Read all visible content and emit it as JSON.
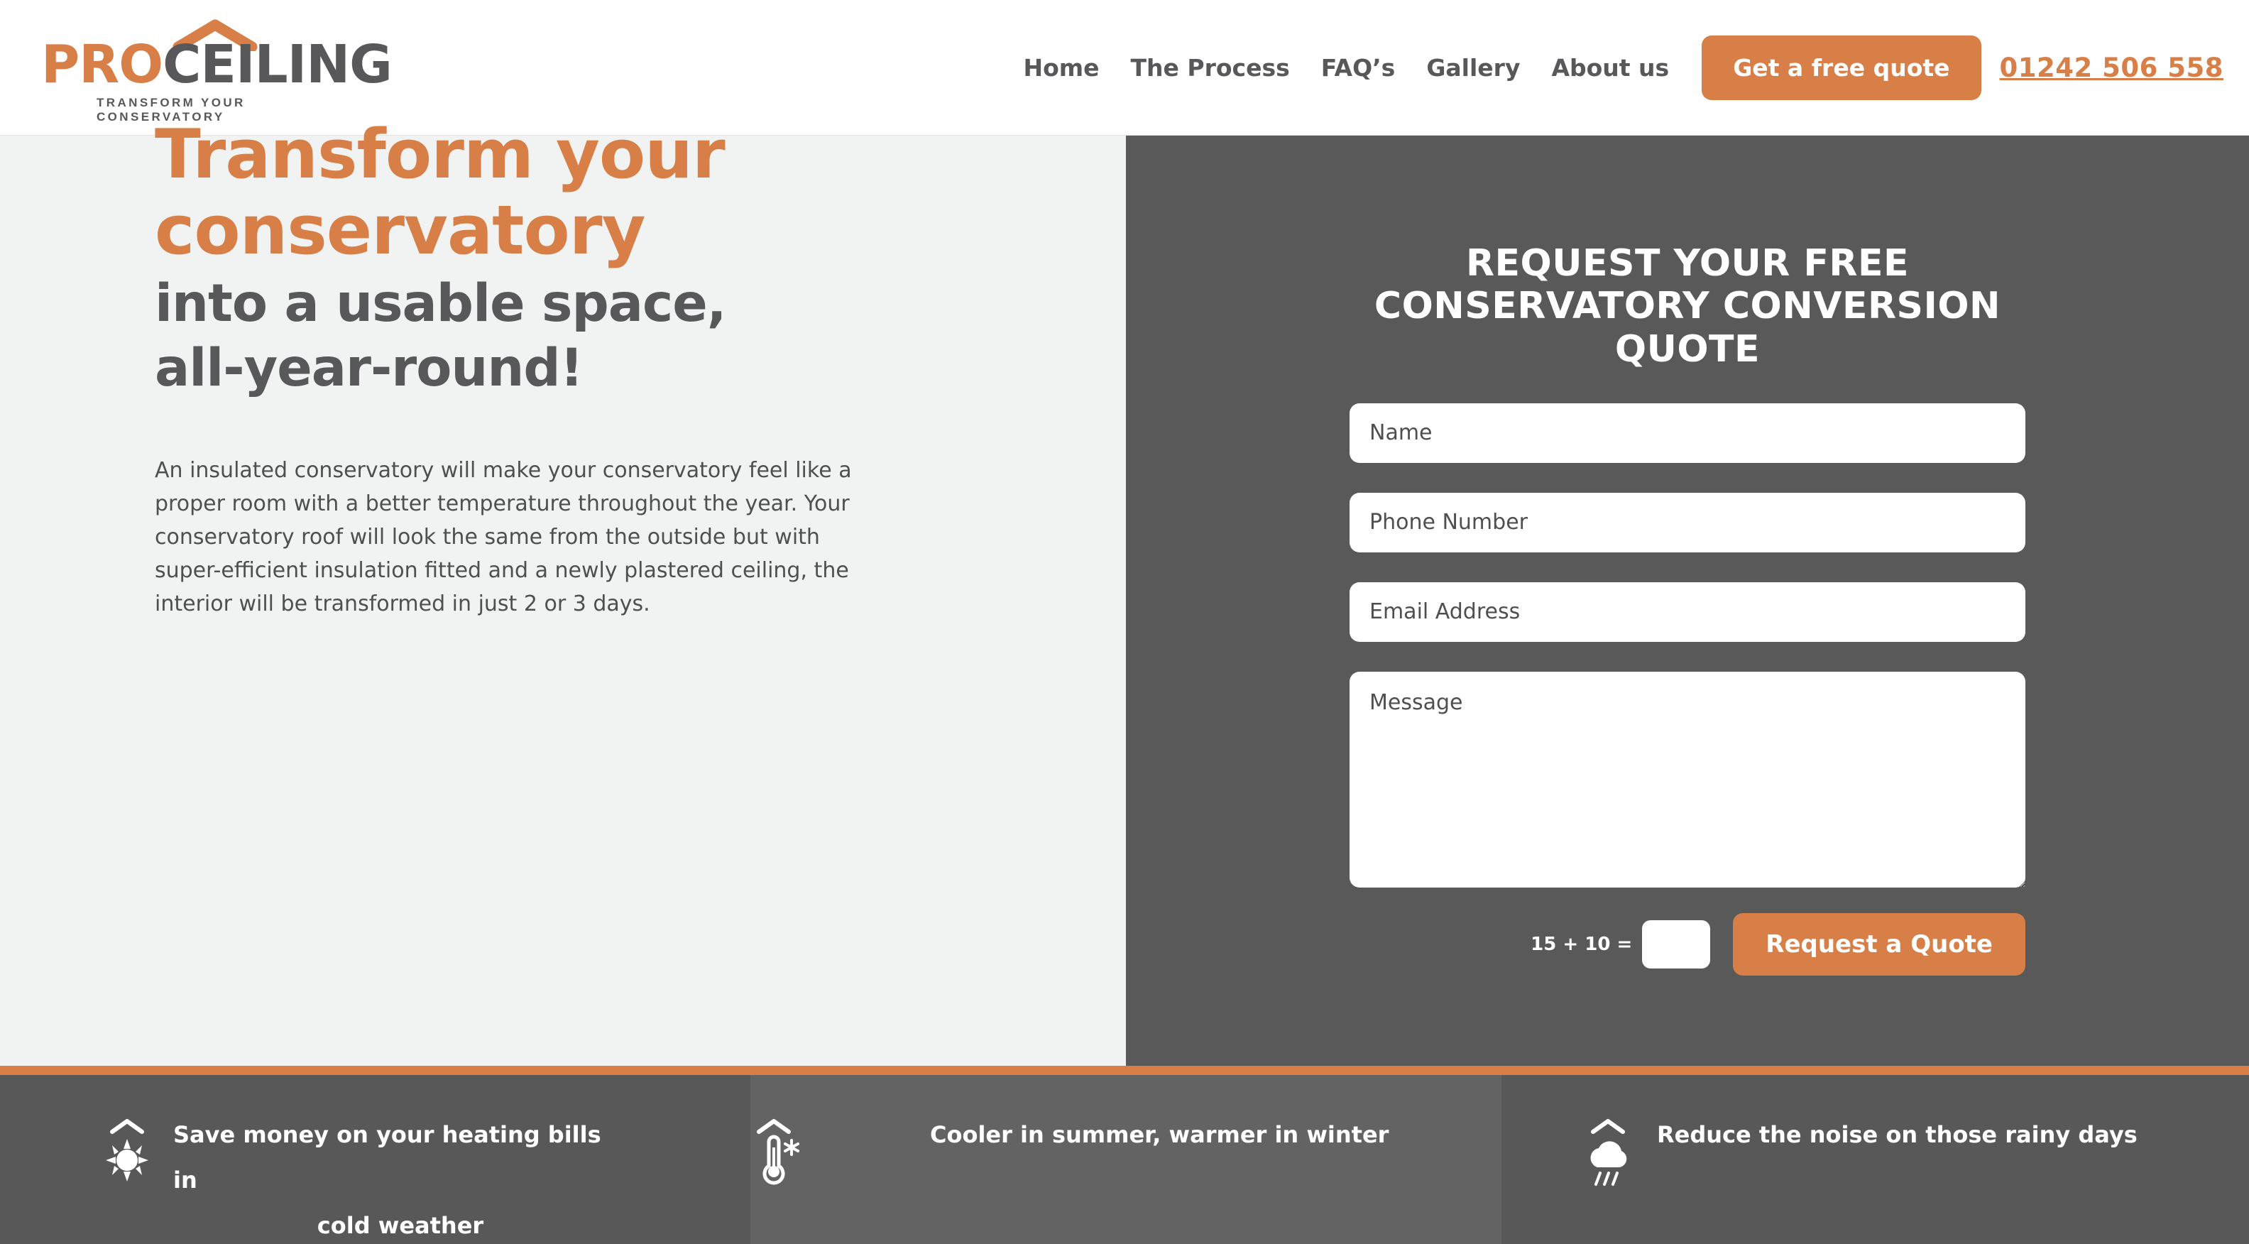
{
  "brand": {
    "logo_pro": "PRO",
    "logo_ceiling": "CEILING",
    "tagline": "TRANSFORM YOUR CONSERVATORY",
    "accent_color": "#d87f47",
    "dark_color": "#58585a",
    "panel_dark": "#595959",
    "panel_light": "#f1f3f2",
    "roof_icon": "roof-chevron-icon"
  },
  "header": {
    "nav": [
      {
        "label": "Home",
        "name": "nav-home"
      },
      {
        "label": "The Process",
        "name": "nav-the-process"
      },
      {
        "label": "FAQ’s",
        "name": "nav-faqs"
      },
      {
        "label": "Gallery",
        "name": "nav-gallery"
      },
      {
        "label": "About us",
        "name": "nav-about-us"
      }
    ],
    "cta_label": "Get a free quote",
    "phone": "01242 506 558"
  },
  "hero": {
    "headline_orange_line1": "Transform your",
    "headline_orange_line2": "conservatory",
    "headline_grey_line1": "into a usable space,",
    "headline_grey_line2": "all-year-round!",
    "body": "An insulated conservatory will make your conservatory feel like a proper room with a better temperature throughout the year. Your conservatory roof will look the same from the outside but with super-efficient insulation fitted and a newly plastered ceiling, the interior will be transformed in just 2 or 3 days."
  },
  "form": {
    "title": "REQUEST YOUR FREE CONSERVATORY CONVERSION QUOTE",
    "name_placeholder": "Name",
    "name_value": "",
    "phone_placeholder": "Phone Number",
    "phone_value": "",
    "email_placeholder": "Email Address",
    "email_value": "",
    "message_placeholder": "Message",
    "message_value": "",
    "captcha_label": "15 + 10 =",
    "captcha_value": "",
    "submit_label": "Request a Quote"
  },
  "features": [
    {
      "icon": "sun-icon",
      "text_line1": "Save money on your heating bills in",
      "text_line2": "cold weather"
    },
    {
      "icon": "thermometer-snowflake-icon",
      "text_line1": "Cooler in summer, warmer in winter",
      "text_line2": ""
    },
    {
      "icon": "rain-cloud-icon",
      "text_line1": "Reduce the noise on those rainy days",
      "text_line2": ""
    }
  ]
}
